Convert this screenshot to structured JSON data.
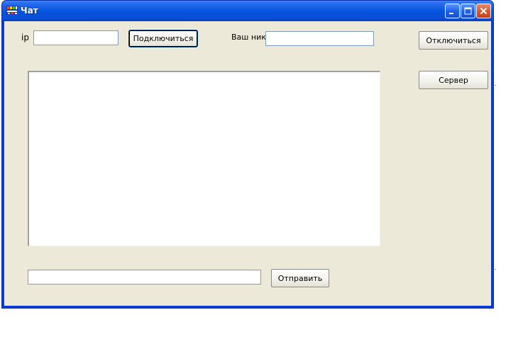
{
  "window": {
    "title": "Чат"
  },
  "connection": {
    "ip_label": "ip",
    "ip_value": "",
    "connect_label": "Подключиться",
    "nick_label": "Ваш ник",
    "nick_value": ""
  },
  "side_buttons": {
    "disconnect_label": "Отключиться",
    "server_label": "Сервер"
  },
  "chat": {
    "log_text": ""
  },
  "compose": {
    "message_value": "",
    "send_label": "Отправить"
  },
  "colors": {
    "titlebar": "#0551dc",
    "client_bg": "#ece9d8",
    "close_button": "#d25733"
  }
}
